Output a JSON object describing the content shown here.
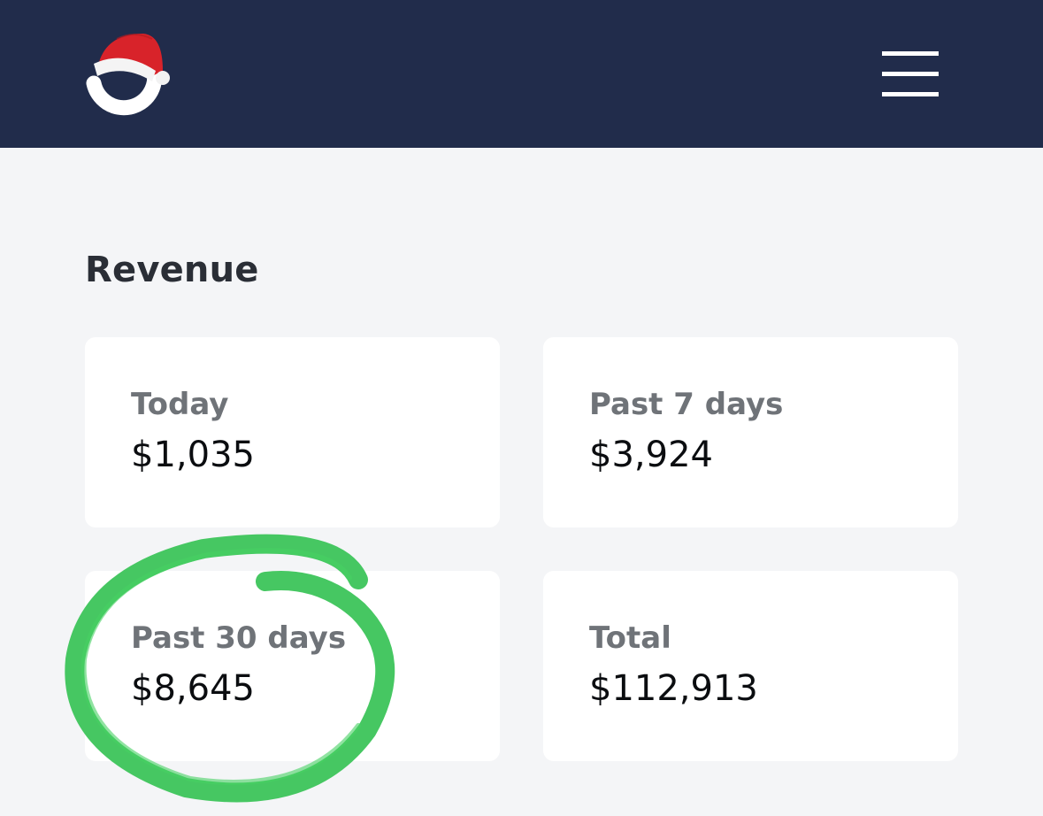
{
  "header": {
    "logo_icon": "santa-hat-logo-icon",
    "menu_icon": "hamburger-menu-icon",
    "background_color": "#212c4b"
  },
  "revenue": {
    "title": "Revenue",
    "cards": [
      {
        "label": "Today",
        "value": "$1,035"
      },
      {
        "label": "Past 7 days",
        "value": "$3,924"
      },
      {
        "label": "Past 30 days",
        "value": "$8,645"
      },
      {
        "label": "Total",
        "value": "$112,913"
      }
    ]
  },
  "annotation": {
    "type": "hand-drawn circle",
    "color": "#3cc45a",
    "target": "Past 30 days"
  }
}
